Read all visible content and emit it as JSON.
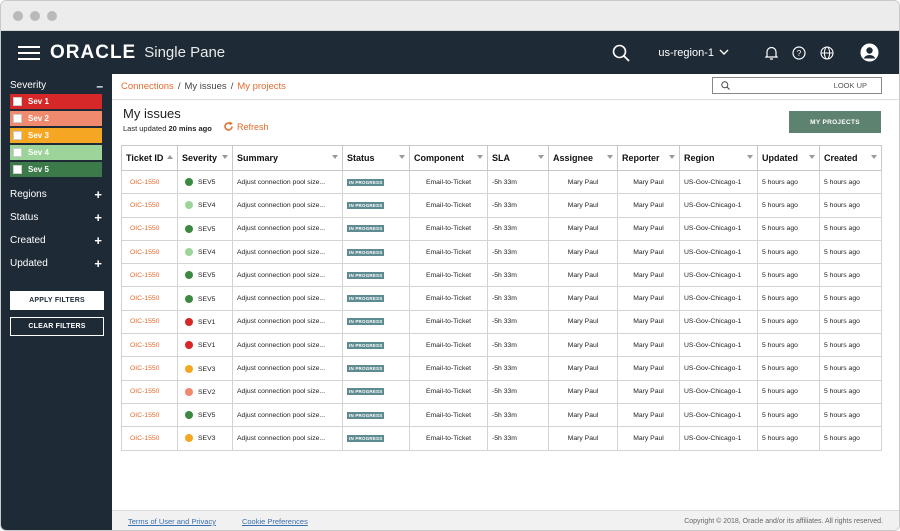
{
  "header": {
    "logo": "ORACLE",
    "app_name": "Single Pane",
    "region": "us-region-1"
  },
  "sidebar": {
    "severity_label": "Severity",
    "severities": [
      {
        "label": "Sev 1",
        "color": "#d62828"
      },
      {
        "label": "Sev 2",
        "color": "#ef8a6e"
      },
      {
        "label": "Sev 3",
        "color": "#f5a623"
      },
      {
        "label": "Sev 4",
        "color": "#9dd49a"
      },
      {
        "label": "Sev 5",
        "color": "#3c7a4a"
      }
    ],
    "filters": [
      "Regions",
      "Status",
      "Created",
      "Updated"
    ],
    "apply_label": "APPLY FILTERS",
    "clear_label": "CLEAR FILTERS"
  },
  "breadcrumb": {
    "items": [
      "Connections",
      "My issues",
      "My projects"
    ]
  },
  "search": {
    "placeholder": "LOOK UP"
  },
  "main": {
    "title": "My issues",
    "updated_prefix": "Last updated",
    "updated_value": "20 mins ago",
    "refresh_label": "Refresh",
    "my_projects_label": "MY PROJECTS"
  },
  "table": {
    "columns": [
      "Ticket ID",
      "Severity",
      "Summary",
      "Status",
      "Component",
      "SLA",
      "Assignee",
      "Reporter",
      "Region",
      "Updated",
      "Created"
    ],
    "rows": [
      {
        "id": "OIC-1550",
        "sev": "SEV5",
        "sev_color": "#3c8a42",
        "summary": "Adjust connection pool size...",
        "status": "IN PROGRESS",
        "component": "Email-to-Ticket",
        "sla": "-5h 33m",
        "assignee": "Mary Paul",
        "reporter": "Mary Paul",
        "region": "US-Gov-Chicago-1",
        "updated": "5 hours ago",
        "created": "5 hours ago"
      },
      {
        "id": "OIC-1550",
        "sev": "SEV4",
        "sev_color": "#9dd49a",
        "summary": "Adjust connection pool size...",
        "status": "IN PROGRESS",
        "component": "Email-to-Ticket",
        "sla": "-5h 33m",
        "assignee": "Mary Paul",
        "reporter": "Mary Paul",
        "region": "US-Gov-Chicago-1",
        "updated": "5 hours ago",
        "created": "5 hours ago"
      },
      {
        "id": "OIC-1550",
        "sev": "SEV5",
        "sev_color": "#3c8a42",
        "summary": "Adjust connection pool size...",
        "status": "IN PROGRESS",
        "component": "Email-to-Ticket",
        "sla": "-5h 33m",
        "assignee": "Mary Paul",
        "reporter": "Mary Paul",
        "region": "US-Gov-Chicago-1",
        "updated": "5 hours ago",
        "created": "5 hours ago"
      },
      {
        "id": "OIC-1550",
        "sev": "SEV4",
        "sev_color": "#9dd49a",
        "summary": "Adjust connection pool size...",
        "status": "IN PROGRESS",
        "component": "Email-to-Ticket",
        "sla": "-5h 33m",
        "assignee": "Mary Paul",
        "reporter": "Mary Paul",
        "region": "US-Gov-Chicago-1",
        "updated": "5 hours ago",
        "created": "5 hours ago"
      },
      {
        "id": "OIC-1550",
        "sev": "SEV5",
        "sev_color": "#3c8a42",
        "summary": "Adjust connection pool size...",
        "status": "IN PROGRESS",
        "component": "Email-to-Ticket",
        "sla": "-5h 33m",
        "assignee": "Mary Paul",
        "reporter": "Mary Paul",
        "region": "US-Gov-Chicago-1",
        "updated": "5 hours ago",
        "created": "5 hours ago"
      },
      {
        "id": "OIC-1550",
        "sev": "SEV5",
        "sev_color": "#3c8a42",
        "summary": "Adjust connection pool size...",
        "status": "IN PROGRESS",
        "component": "Email-to-Ticket",
        "sla": "-5h 33m",
        "assignee": "Mary Paul",
        "reporter": "Mary Paul",
        "region": "US-Gov-Chicago-1",
        "updated": "5 hours ago",
        "created": "5 hours ago"
      },
      {
        "id": "OIC-1550",
        "sev": "SEV1",
        "sev_color": "#d62828",
        "summary": "Adjust connection pool size...",
        "status": "IN PROGRESS",
        "component": "Email-to-Ticket",
        "sla": "-5h 33m",
        "assignee": "Mary Paul",
        "reporter": "Mary Paul",
        "region": "US-Gov-Chicago-1",
        "updated": "5 hours ago",
        "created": "5 hours ago"
      },
      {
        "id": "OIC-1550",
        "sev": "SEV1",
        "sev_color": "#d62828",
        "summary": "Adjust connection pool size...",
        "status": "IN PROGRESS",
        "component": "Email-to-Ticket",
        "sla": "-5h 33m",
        "assignee": "Mary Paul",
        "reporter": "Mary Paul",
        "region": "US-Gov-Chicago-1",
        "updated": "5 hours ago",
        "created": "5 hours ago"
      },
      {
        "id": "OIC-1550",
        "sev": "SEV3",
        "sev_color": "#f5a623",
        "summary": "Adjust connection pool size...",
        "status": "IN PROGRESS",
        "component": "Email-to-Ticket",
        "sla": "-5h 33m",
        "assignee": "Mary Paul",
        "reporter": "Mary Paul",
        "region": "US-Gov-Chicago-1",
        "updated": "5 hours ago",
        "created": "5 hours ago"
      },
      {
        "id": "OIC-1550",
        "sev": "SEV2",
        "sev_color": "#ef8a6e",
        "summary": "Adjust connection pool size...",
        "status": "IN PROGRESS",
        "component": "Email-to-Ticket",
        "sla": "-5h 33m",
        "assignee": "Mary Paul",
        "reporter": "Mary Paul",
        "region": "US-Gov-Chicago-1",
        "updated": "5 hours ago",
        "created": "5 hours ago"
      },
      {
        "id": "OIC-1550",
        "sev": "SEV5",
        "sev_color": "#3c8a42",
        "summary": "Adjust connection pool size...",
        "status": "IN PROGRESS",
        "component": "Email-to-Ticket",
        "sla": "-5h 33m",
        "assignee": "Mary Paul",
        "reporter": "Mary Paul",
        "region": "US-Gov-Chicago-1",
        "updated": "5 hours ago",
        "created": "5 hours ago"
      },
      {
        "id": "OIC-1550",
        "sev": "SEV3",
        "sev_color": "#f5a623",
        "summary": "Adjust connection pool size...",
        "status": "IN PROGRESS",
        "component": "Email-to-Ticket",
        "sla": "-5h 33m",
        "assignee": "Mary Paul",
        "reporter": "Mary Paul",
        "region": "US-Gov-Chicago-1",
        "updated": "5 hours ago",
        "created": "5 hours ago"
      }
    ]
  },
  "footer": {
    "terms_label": "Terms of User and Privacy",
    "cookies_label": "Cookie Preferences",
    "copyright": "Copyright © 2018, Oracle and/or its affiliates. All rights reserved."
  }
}
